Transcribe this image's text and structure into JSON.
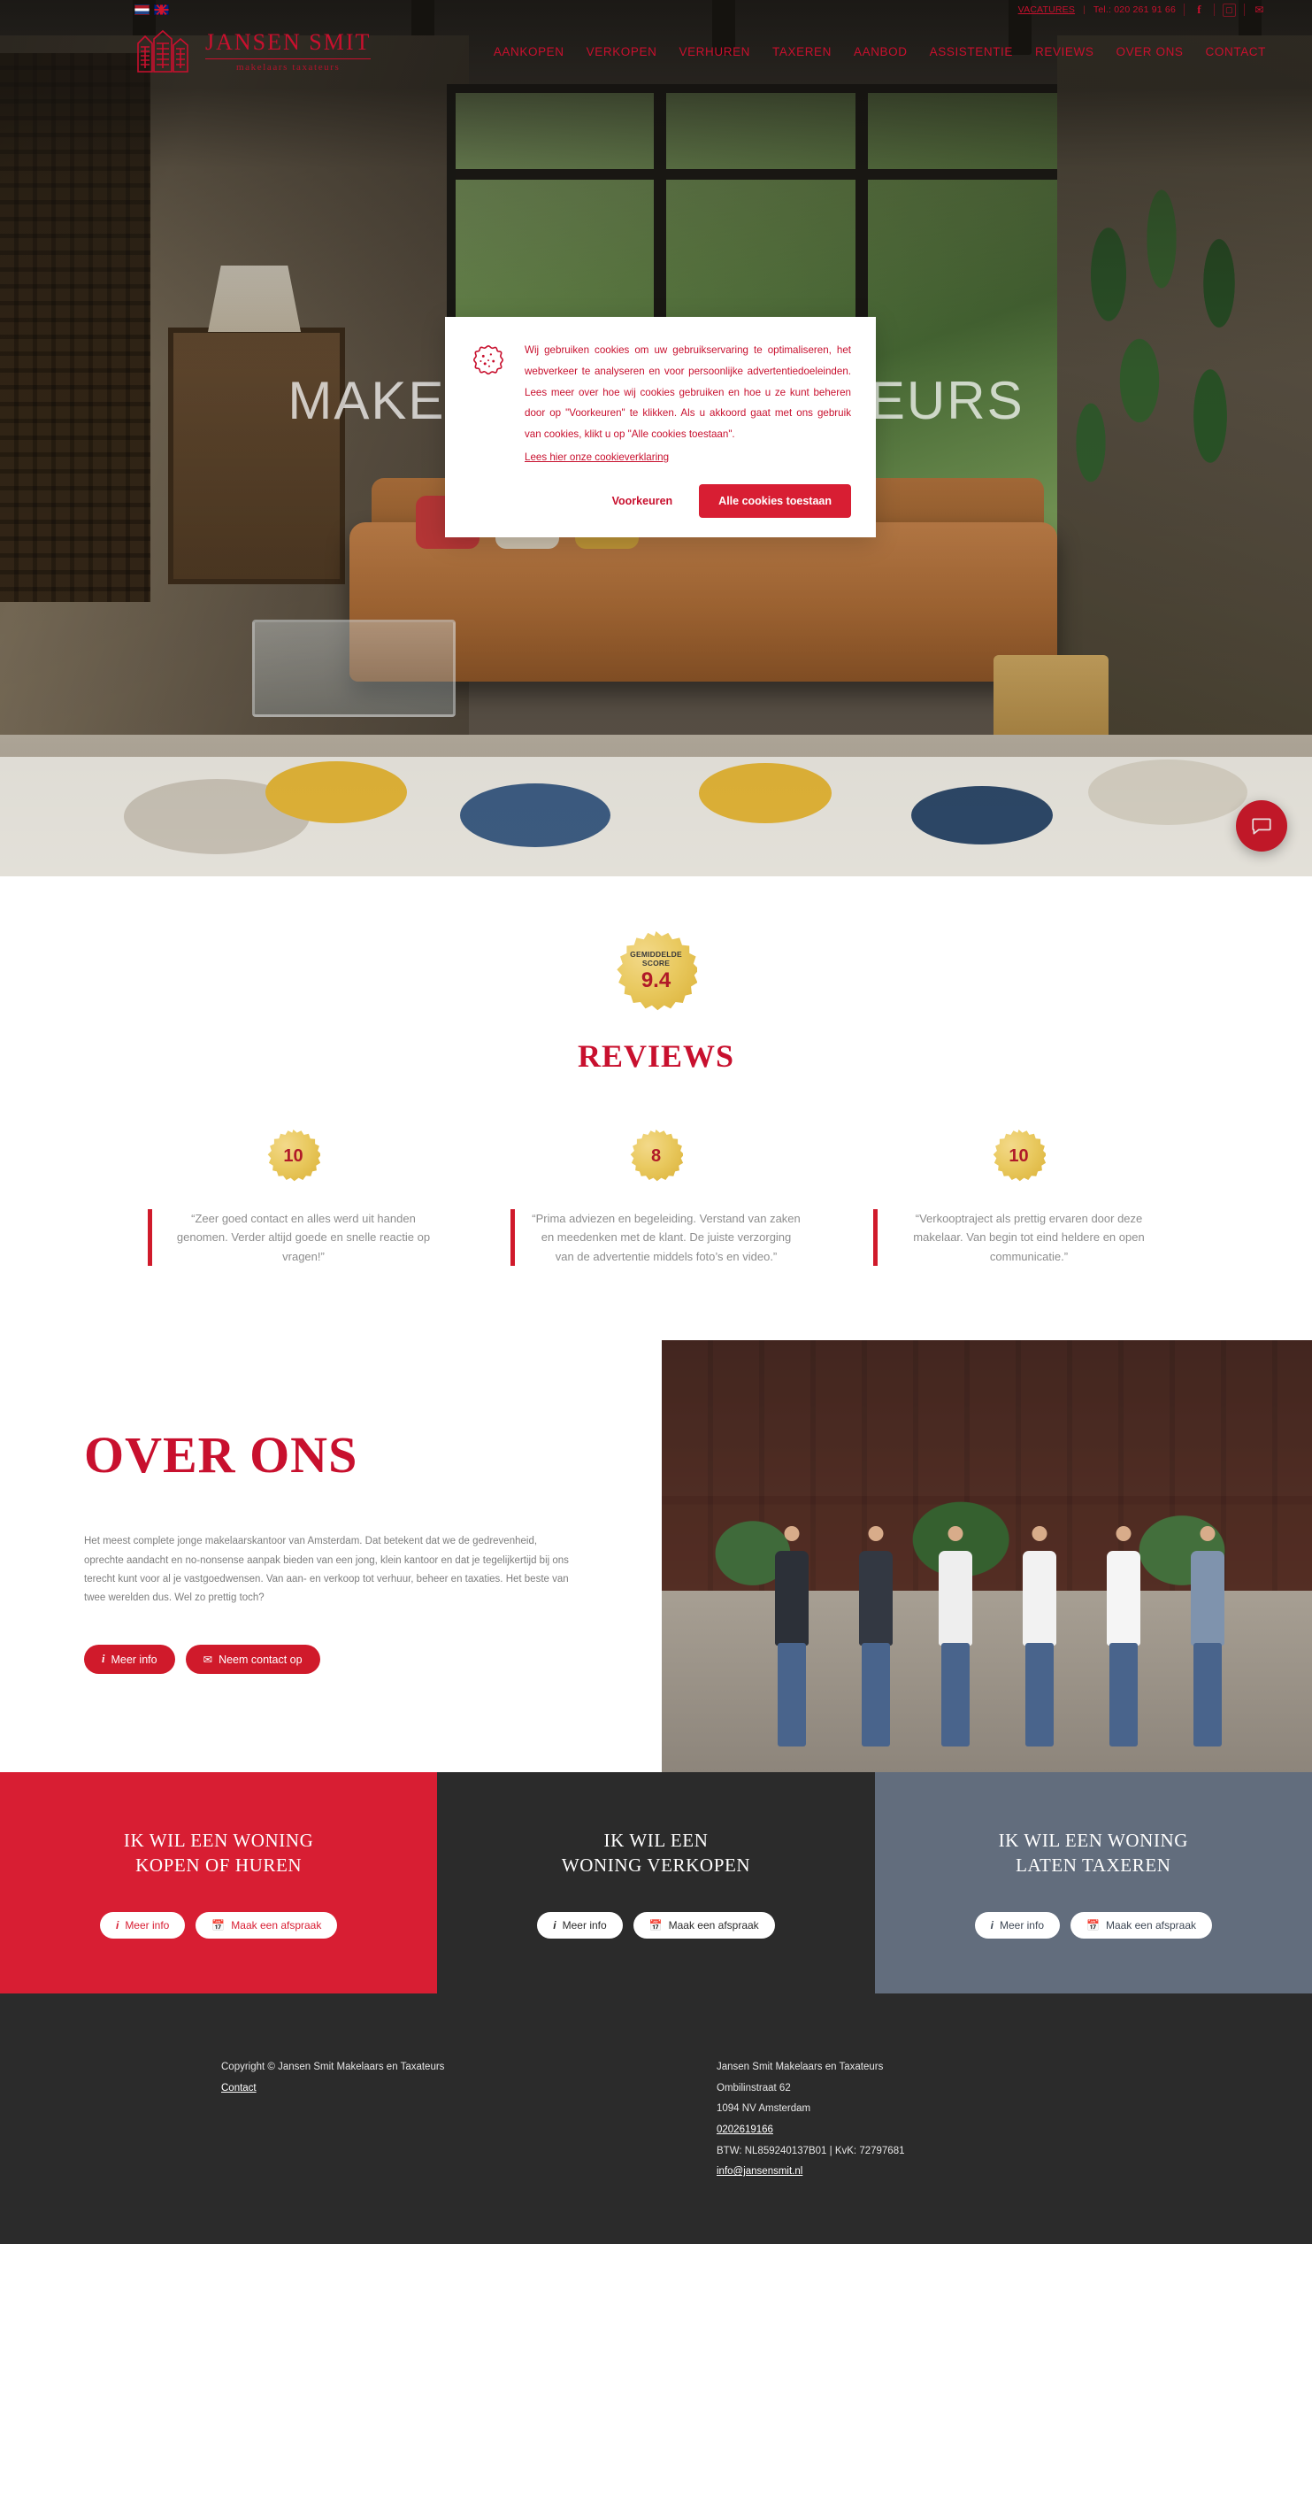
{
  "topbar": {
    "flags": [
      {
        "name": "dutch-flag",
        "alt": "Nederlands"
      },
      {
        "name": "uk-flag",
        "alt": "English"
      }
    ],
    "vacatures": "VACATURES",
    "separator": "|",
    "phone": "Tel.: 020 261 91 66",
    "facebook_icon": "facebook-icon",
    "instagram_icon": "instagram-icon",
    "mail_icon": "mail-icon"
  },
  "header": {
    "logo_name": "JANSEN SMIT",
    "logo_sub": "makelaars taxateurs",
    "nav": [
      {
        "label": "AANKOPEN"
      },
      {
        "label": "VERKOPEN"
      },
      {
        "label": "VERHUREN"
      },
      {
        "label": "TAXEREN"
      },
      {
        "label": "AANBOD"
      },
      {
        "label": "ASSISTENTIE"
      },
      {
        "label": "REVIEWS"
      },
      {
        "label": "OVER ONS"
      },
      {
        "label": "CONTACT"
      }
    ]
  },
  "hero": {
    "title": "MAKELAARS & TAXATEURS",
    "chat_icon": "chat-bubble-icon"
  },
  "cookie": {
    "icon": "cookie-icon",
    "text": "Wij gebruiken cookies om uw gebruikservaring te optimaliseren, het webverkeer te analyseren en voor persoonlijke advertentiedoeleinden. Lees meer over hoe wij cookies gebruiken en hoe u ze kunt beheren door op \"Voorkeuren\" te klikken. Als u akkoord gaat met ons gebruik van cookies, klikt u op \"Alle cookies toestaan\".",
    "link": "Lees hier onze cookieverklaring",
    "preferences_label": "Voorkeuren",
    "accept_label": "Alle cookies toestaan",
    "accent_color": "#d81e33"
  },
  "reviews": {
    "score_label_line1": "GEMIDDELDE",
    "score_label_line2": "SCORE",
    "score_value": "9.4",
    "heading": "REVIEWS",
    "items": [
      {
        "score": "10",
        "quote": "“Zeer goed contact en alles werd uit handen genomen. Verder altijd goede en snelle reactie op vragen!”"
      },
      {
        "score": "8",
        "quote": "“Prima adviezen en begeleiding. Verstand van zaken en meedenken met de klant. De juiste verzorging van de advertentie middels foto’s en video.”"
      },
      {
        "score": "10",
        "quote": "“Verkooptraject als prettig ervaren door deze makelaar. Van begin tot eind heldere en open communicatie.”"
      }
    ]
  },
  "about": {
    "title": "OVER ONS",
    "text": "Het meest complete jonge makelaarskantoor van Amsterdam. Dat betekent dat we de gedrevenheid, oprechte aandacht en no-nonsense aanpak bieden van een jong, klein kantoor en dat je tegelijkertijd bij ons terecht kunt voor al je vastgoedwensen. Van aan- en verkoop tot verhuur, beheer en taxaties. Het beste van twee werelden dus. Wel zo prettig toch?",
    "button_info": "Meer info",
    "button_contact": "Neem contact op",
    "info_icon": "info-icon",
    "mail_icon": "mail-icon",
    "photo_alt": "team-photo"
  },
  "cta": {
    "panels": [
      {
        "title_line1": "IK WIL EEN WONING",
        "title_line2": "KOPEN OF HUREN",
        "button_info": "Meer info",
        "button_appointment": "Maak een afspraak",
        "color": "#d81e33"
      },
      {
        "title_line1": "IK WIL EEN",
        "title_line2": "WONING VERKOPEN",
        "button_info": "Meer info",
        "button_appointment": "Maak een afspraak",
        "color": "#2b2b2b"
      },
      {
        "title_line1": "IK WIL EEN WONING",
        "title_line2": "LATEN TAXEREN",
        "button_info": "Meer info",
        "button_appointment": "Maak een afspraak",
        "color": "#626d7d"
      }
    ]
  },
  "footer": {
    "copyright": "Copyright © Jansen Smit Makelaars en Taxateurs",
    "contact_link": "Contact",
    "company": "Jansen Smit Makelaars en Taxateurs",
    "street": "Ombilinstraat 62",
    "city": "1094 NV Amsterdam",
    "phone": "0202619166",
    "registration": "BTW: NL859240137B01 | KvK: 72797681",
    "email": "info@jansensmit.nl"
  }
}
